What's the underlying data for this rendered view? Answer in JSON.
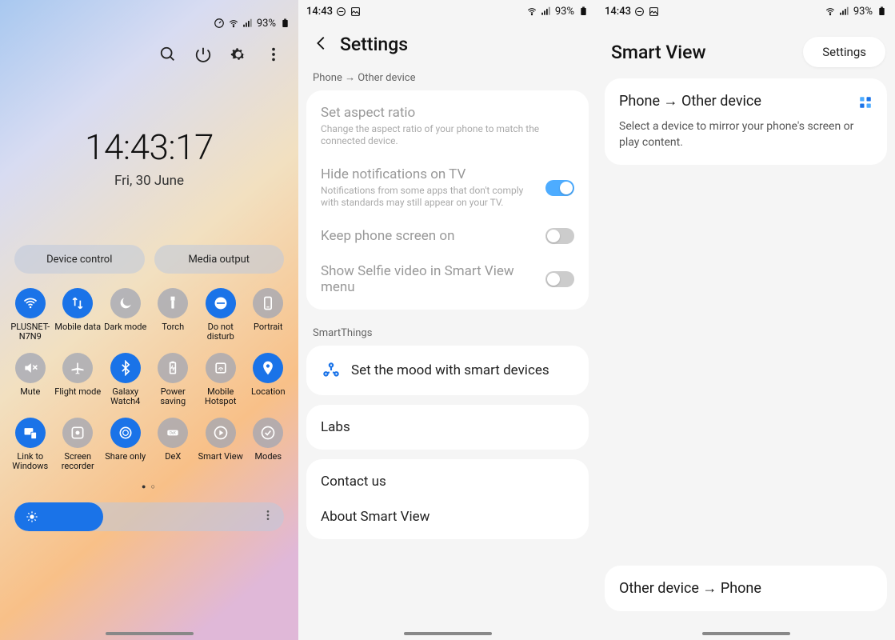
{
  "status": {
    "time": "14:43",
    "battery": "93%"
  },
  "panel1": {
    "clock": "14:43:17",
    "date": "Fri, 30 June",
    "pills": [
      "Device control",
      "Media output"
    ],
    "tiles": [
      {
        "label": "PLUSNET-N7N9",
        "on": true,
        "icon": "wifi"
      },
      {
        "label": "Mobile data",
        "on": true,
        "icon": "updown"
      },
      {
        "label": "Dark mode",
        "on": false,
        "icon": "moon"
      },
      {
        "label": "Torch",
        "on": false,
        "icon": "torch"
      },
      {
        "label": "Do not disturb",
        "on": true,
        "icon": "dnd"
      },
      {
        "label": "Portrait",
        "on": false,
        "icon": "portrait"
      },
      {
        "label": "Mute",
        "on": false,
        "icon": "mute"
      },
      {
        "label": "Flight mode",
        "on": false,
        "icon": "plane"
      },
      {
        "label": "Galaxy Watch4",
        "on": true,
        "icon": "bt"
      },
      {
        "label": "Power saving",
        "on": false,
        "icon": "battery"
      },
      {
        "label": "Mobile Hotspot",
        "on": false,
        "icon": "hotspot"
      },
      {
        "label": "Location",
        "on": true,
        "icon": "pin"
      },
      {
        "label": "Link to Windows",
        "on": true,
        "icon": "link"
      },
      {
        "label": "Screen recorder",
        "on": false,
        "icon": "rec"
      },
      {
        "label": "Share only",
        "on": true,
        "icon": "share"
      },
      {
        "label": "DeX",
        "on": false,
        "icon": "dex"
      },
      {
        "label": "Smart View",
        "on": false,
        "icon": "cast"
      },
      {
        "label": "Modes",
        "on": false,
        "icon": "modes"
      }
    ]
  },
  "panel2": {
    "title": "Settings",
    "breadcrumb": "Phone → Other device",
    "rows": {
      "aspect": {
        "t": "Set aspect ratio",
        "s": "Change the aspect ratio of your phone to match the connected device."
      },
      "hide": {
        "t": "Hide notifications on TV",
        "s": "Notifications from some apps that don't comply with standards may still appear on your TV.",
        "on": true
      },
      "keep": {
        "t": "Keep phone screen on",
        "on": false
      },
      "selfie": {
        "t": "Show Selfie video in Smart View menu",
        "on": false
      }
    },
    "st_label": "SmartThings",
    "st_row": "Set the mood with smart devices",
    "labs": "Labs",
    "contact": "Contact us",
    "about": "About Smart View"
  },
  "panel3": {
    "title": "Smart View",
    "chip": "Settings",
    "card_title": "Phone → Other device",
    "card_sub": "Select a device to mirror your phone's screen or play content.",
    "bottom": "Other device → Phone"
  }
}
